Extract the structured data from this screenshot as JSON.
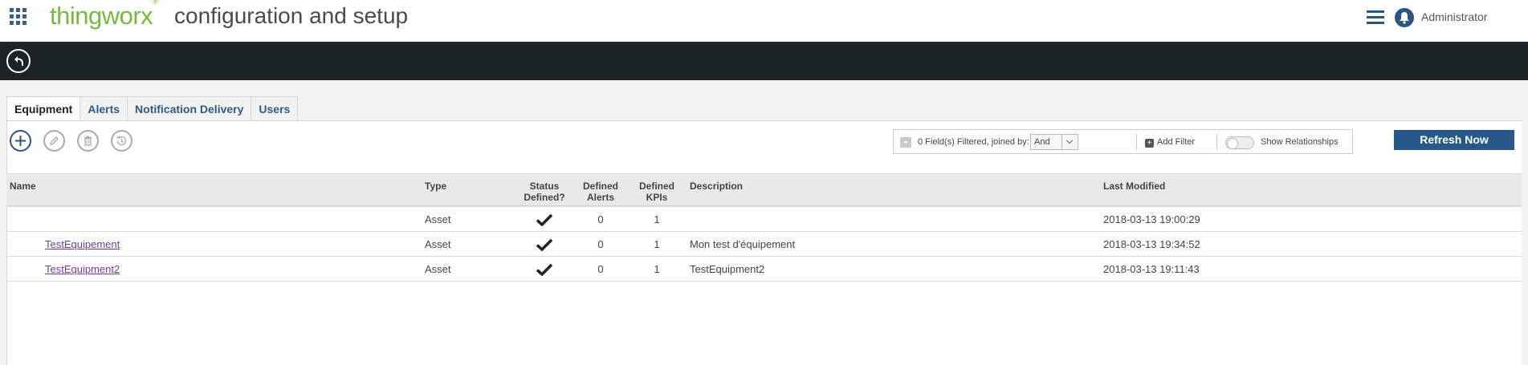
{
  "header": {
    "brand": "thingworx",
    "brand_mark": "®",
    "title": "configuration and setup",
    "user": "Administrator",
    "apps_icon": "apps-grid-icon",
    "menu_icon": "hamburger-menu-icon",
    "notification_icon": "bell-icon"
  },
  "toolbar_dark": {
    "back_icon": "back-arrow-icon"
  },
  "tabs": [
    {
      "label": "Equipment",
      "active": true
    },
    {
      "label": "Alerts",
      "active": false
    },
    {
      "label": "Notification Delivery",
      "active": false
    },
    {
      "label": "Users",
      "active": false
    }
  ],
  "actions": {
    "add_icon": "add-icon",
    "edit_icon": "edit-icon",
    "delete_icon": "delete-icon",
    "history_icon": "history-icon"
  },
  "filter": {
    "summary": "0 Field(s) Filtered, joined by:",
    "join_value": "And",
    "add_filter_label": "Add Filter",
    "show_relationships_label": "Show Relationships",
    "show_relationships_on": false
  },
  "refresh_label": "Refresh Now",
  "grid": {
    "columns": {
      "name": "Name",
      "type": "Type",
      "status_line1": "Status",
      "status_line2": "Defined?",
      "alerts_line1": "Defined",
      "alerts_line2": "Alerts",
      "kpis_line1": "Defined",
      "kpis_line2": "KPIs",
      "description": "Description",
      "last_modified": "Last Modified"
    },
    "rows": [
      {
        "name": "",
        "type": "Asset",
        "status_defined": true,
        "alerts": "0",
        "kpis": "1",
        "description": "",
        "last_modified": "2018-03-13 19:00:29"
      },
      {
        "name": "TestEquipement",
        "type": "Asset",
        "status_defined": true,
        "alerts": "0",
        "kpis": "1",
        "description": "Mon test d'équipement",
        "last_modified": "2018-03-13 19:34:52"
      },
      {
        "name": "TestEquipment2",
        "type": "Asset",
        "status_defined": true,
        "alerts": "0",
        "kpis": "1",
        "description": "TestEquipment2",
        "last_modified": "2018-03-13 19:11:43"
      }
    ]
  },
  "colors": {
    "brand_green": "#79b83e",
    "accent_blue": "#26588a",
    "dark_bar": "#1c2327",
    "link_purple": "#6b3f93"
  }
}
